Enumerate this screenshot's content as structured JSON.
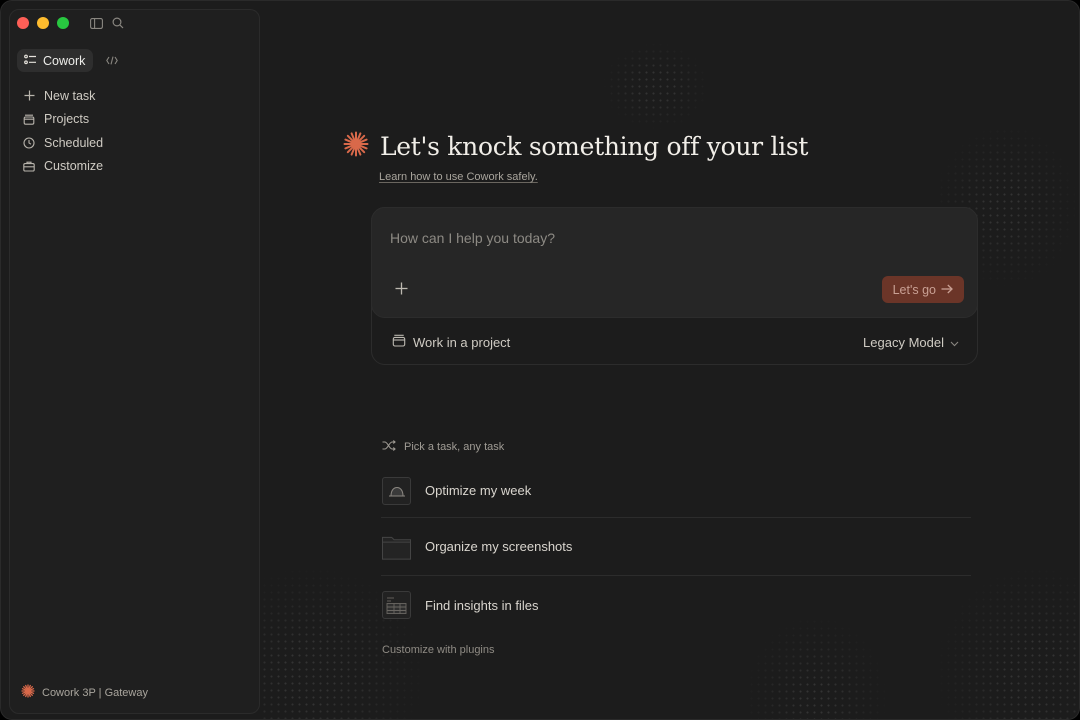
{
  "window": {
    "colors": {
      "accent": "#d9694a",
      "go_button_bg": "#6b3528"
    }
  },
  "sidebar": {
    "mode": {
      "label": "Cowork",
      "icon": "checklist-icon",
      "secondary_icon": "code-icon"
    },
    "items": [
      {
        "label": "New task",
        "icon": "plus-icon"
      },
      {
        "label": "Projects",
        "icon": "archive-icon"
      },
      {
        "label": "Scheduled",
        "icon": "clock-icon"
      },
      {
        "label": "Customize",
        "icon": "briefcase-icon"
      }
    ],
    "footer": {
      "label": "Cowork 3P | Gateway",
      "icon": "asterisk-logo-icon"
    }
  },
  "main": {
    "headline": "Let's knock something off your list",
    "learn_link": "Learn how to use Cowork safely.",
    "composer": {
      "placeholder": "How can I help you today?",
      "submit_label": "Let's go",
      "project_label": "Work in a project",
      "model_label": "Legacy Model"
    },
    "tasks": {
      "heading": "Pick a task, any task",
      "items": [
        {
          "label": "Optimize my week",
          "icon": "calendar-thumb-icon"
        },
        {
          "label": "Organize my screenshots",
          "icon": "folder-thumb-icon"
        },
        {
          "label": "Find insights in files",
          "icon": "spreadsheet-thumb-icon"
        }
      ],
      "footer": "Customize with plugins"
    }
  }
}
